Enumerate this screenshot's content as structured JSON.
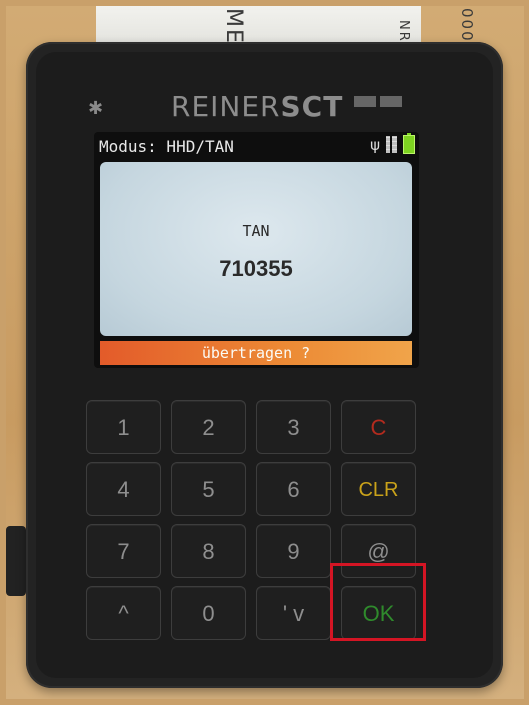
{
  "card": {
    "line_a": "ME",
    "line_b": "NR",
    "line_c": "000"
  },
  "device": {
    "brand_light": "REINER",
    "brand_bold": "SCT",
    "icons": [
      "bluetooth-icon",
      "usb-icon",
      "signal-grid-icon",
      "battery-icon"
    ]
  },
  "screen": {
    "status_label": "Modus: HHD/TAN",
    "title": "TAN",
    "tan_value": "710355",
    "prompt": "übertragen ?"
  },
  "keys": [
    "1",
    "2",
    "3",
    "C",
    "4",
    "5",
    "6",
    "CLR",
    "7",
    "8",
    "9",
    "@",
    "^",
    "0",
    "' v",
    "OK"
  ],
  "colors": {
    "prompt_bar": "#e35b2a",
    "key_cancel": "#b32b1e",
    "key_clear": "#c9a21a",
    "key_ok": "#2f8a2c",
    "battery": "#7ed321",
    "highlight": "#d41524"
  }
}
